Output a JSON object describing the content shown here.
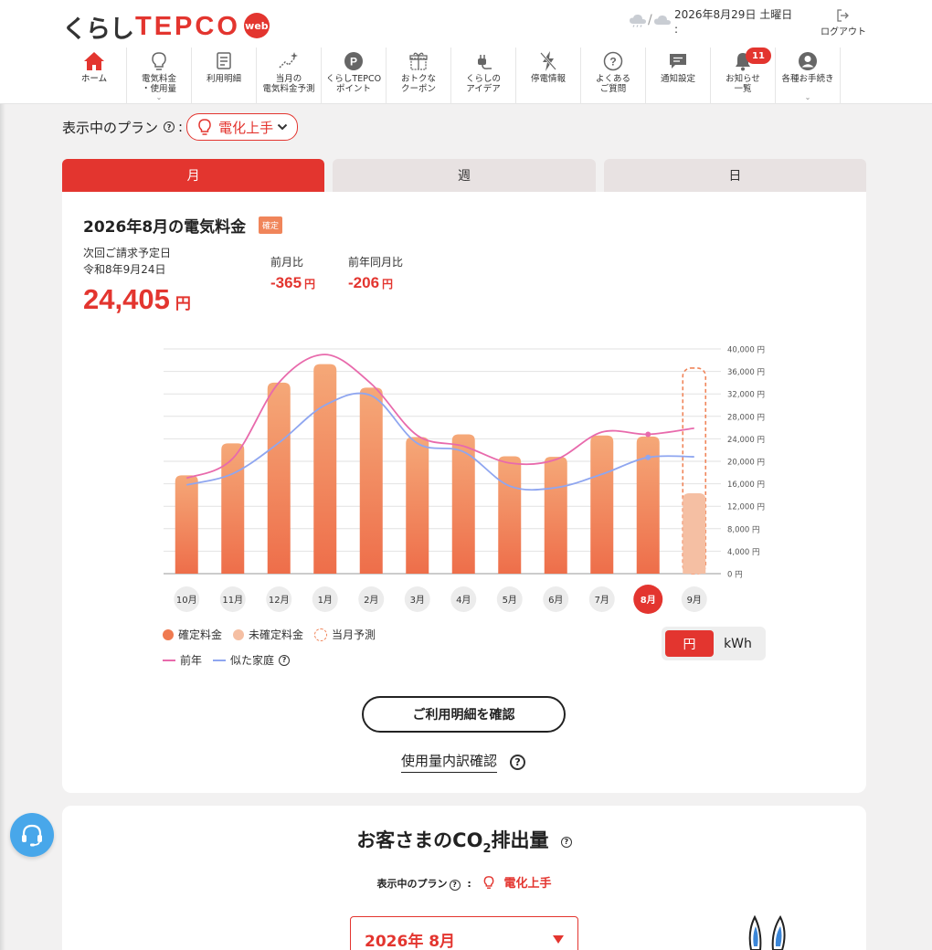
{
  "header": {
    "logo_kurashi": "くらし",
    "logo_tepco": "TEPCO",
    "logo_web": "web",
    "date_text": "2026年8月29日 土曜日",
    "date_suffix": ":",
    "logout_label": "ログアウト"
  },
  "nav": [
    {
      "label": "ホーム",
      "icon": "home-icon"
    },
    {
      "label": "電気料金\n・使用量",
      "icon": "bulb-icon",
      "chevron": true
    },
    {
      "label": "利用明細",
      "icon": "document-icon"
    },
    {
      "label": "当月の\n電気料金予測",
      "icon": "sparkle-chart-icon"
    },
    {
      "label": "くらしTEPCO\nポイント",
      "icon": "point-icon",
      "icon_text": "P"
    },
    {
      "label": "おトクな\nクーポン",
      "icon": "gift-icon"
    },
    {
      "label": "くらしの\nアイデア",
      "icon": "plug-icon"
    },
    {
      "label": "停電情報",
      "icon": "lightning-icon"
    },
    {
      "label": "よくある\nご質問",
      "icon": "question-icon",
      "icon_text": "?"
    },
    {
      "label": "通知設定",
      "icon": "message-icon"
    },
    {
      "label": "お知らせ\n一覧",
      "icon": "bell-icon",
      "badge": "11"
    },
    {
      "label": "各種お手続き",
      "icon": "user-icon",
      "chevron": true
    }
  ],
  "plan": {
    "label": "表示中のプラン",
    "help": "?",
    "colon": ":",
    "selected": "電化上手"
  },
  "tabs": [
    {
      "label": "月",
      "active": true
    },
    {
      "label": "週",
      "active": false
    },
    {
      "label": "日",
      "active": false
    }
  ],
  "bill": {
    "title": "2026年8月の電気料金",
    "status": "確定",
    "next_billing_label": "次回ご請求予定日",
    "next_billing_date": "令和8年9月24日",
    "amount": "24,405",
    "currency": "円",
    "prev_month_label": "前月比",
    "prev_month_value": "-365",
    "prev_year_label": "前年同月比",
    "prev_year_value": "-206"
  },
  "chart_data": {
    "type": "bar",
    "categories": [
      "10月",
      "11月",
      "12月",
      "1月",
      "2月",
      "3月",
      "4月",
      "5月",
      "6月",
      "7月",
      "8月",
      "9月"
    ],
    "selected_category": "8月",
    "ylim": [
      0,
      40000
    ],
    "yticks": [
      "0 円",
      "4,000 円",
      "8,000 円",
      "12,000 円",
      "16,000 円",
      "20,000 円",
      "24,000 円",
      "28,000 円",
      "32,000 円",
      "36,000 円",
      "40,000 円"
    ],
    "ytick_values": [
      0,
      4000,
      8000,
      12000,
      16000,
      20000,
      24000,
      28000,
      32000,
      36000,
      40000
    ],
    "series": [
      {
        "name": "確定料金",
        "values": [
          17500,
          23200,
          34000,
          37300,
          33100,
          24300,
          24800,
          20900,
          20800,
          24600,
          24405,
          null
        ],
        "color": "#ef7a50"
      },
      {
        "name": "未確定料金",
        "values": [
          null,
          null,
          null,
          null,
          null,
          null,
          null,
          null,
          null,
          null,
          null,
          14300
        ],
        "color": "#f5bfa3"
      },
      {
        "name": "当月予測",
        "values": [
          null,
          null,
          null,
          null,
          null,
          null,
          null,
          null,
          null,
          null,
          null,
          36600
        ],
        "color": "#f0855a"
      },
      {
        "name": "前年",
        "values": [
          17000,
          20500,
          34000,
          39000,
          33800,
          24600,
          22700,
          19700,
          20300,
          25200,
          24800,
          25900
        ],
        "color": "#e86aac"
      },
      {
        "name": "似た家庭",
        "values": [
          15800,
          17800,
          23300,
          30000,
          31700,
          23200,
          21700,
          15600,
          15300,
          17700,
          20700,
          20800
        ],
        "color": "#8fa6f0"
      }
    ],
    "legend": [
      "確定料金",
      "未確定料金",
      "当月予測",
      "前年",
      "似た家庭"
    ],
    "legend_help": "?"
  },
  "unit_toggle": {
    "yen": "円",
    "kwh": "kWh",
    "selected": "円"
  },
  "detail_button": "ご利用明細を確認",
  "breakdown_link": "使用量内訳確認",
  "breakdown_help": "?",
  "co2": {
    "title_main": "お客さまのCO",
    "title_sub": "2",
    "title_end": "排出量",
    "help": "?",
    "plan_label": "表示中のプラン",
    "plan_colon": ":",
    "plan_value": "電化上手",
    "month": "2026年 8月"
  },
  "colors": {
    "accent": "#e3352f",
    "bar": "#ef7a50",
    "bar_pending": "#f5bfa3",
    "prev_year": "#e86aac",
    "similar": "#8fa6f0",
    "chat": "#48a7ea"
  }
}
